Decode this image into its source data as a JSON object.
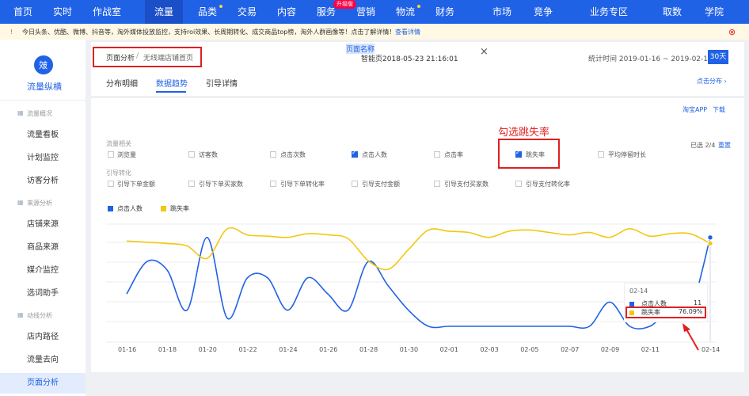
{
  "topnav": {
    "items": [
      "首页",
      "实时",
      "作战室",
      "流量",
      "品类",
      "交易",
      "内容",
      "服务",
      "营销",
      "物流",
      "财务",
      "市场",
      "竞争",
      "业务专区",
      "取数",
      "学院"
    ],
    "active": "流量",
    "upgrade_badge": "升级版"
  },
  "notice": {
    "icon": "!",
    "text": "今日头条、优酷、微博、抖音等，淘外媒体投放监控，支持roi效果、长周期转化、成交商品top榜，淘外人群画像等！点击了解详情！",
    "link": "查看详情",
    "close": "⊗"
  },
  "sidebar": {
    "logo_glyph": "㿰",
    "title": "流量纵横",
    "groups": [
      {
        "label": "流量概况",
        "items": [
          "流量看板",
          "计划监控",
          "访客分析"
        ]
      },
      {
        "label": "来源分析",
        "items": [
          "店铺来源",
          "商品来源",
          "媒介监控",
          "选词助手"
        ]
      },
      {
        "label": "动线分析",
        "items": [
          "店内路径",
          "流量去向",
          "页面分析"
        ]
      }
    ],
    "active": "页面分析"
  },
  "header": {
    "breadcrumb_root": "页面分析",
    "breadcrumb_sep": "/",
    "breadcrumb_current": "无线端店铺首页",
    "page_name_label": "页面名称",
    "page_name_value": "智能页2018-05-23 21:16:01",
    "close": "×",
    "stats_range": "统计时间 2019-01-16 ~ 2019-02-14",
    "range_button": "30天",
    "tabs": [
      "分布明细",
      "数据趋势",
      "引导详情"
    ],
    "active_tab": "数据趋势",
    "right_link": "点击分布 ›"
  },
  "panel": {
    "source_label": "淘宝APP",
    "download": "下载",
    "annotation": "勾选跳失率",
    "selected_count": "已选 2/4",
    "reset": "重置",
    "group1": "流量相关",
    "metrics1": [
      {
        "label": "浏览量",
        "checked": false
      },
      {
        "label": "访客数",
        "checked": false
      },
      {
        "label": "点击次数",
        "checked": false
      },
      {
        "label": "点击人数",
        "checked": true
      },
      {
        "label": "点击率",
        "checked": false
      },
      {
        "label": "跳失率",
        "checked": true
      },
      {
        "label": "平均停留时长",
        "checked": false
      }
    ],
    "group2": "引导转化",
    "metrics2": [
      {
        "label": "引导下单金额",
        "checked": false
      },
      {
        "label": "引导下单买家数",
        "checked": false
      },
      {
        "label": "引导下单转化率",
        "checked": false
      },
      {
        "label": "引导支付金额",
        "checked": false
      },
      {
        "label": "引导支付买家数",
        "checked": false
      },
      {
        "label": "引导支付转化率",
        "checked": false
      }
    ]
  },
  "chart_data": {
    "type": "line",
    "x": [
      "01-16",
      "01-17",
      "01-18",
      "01-19",
      "01-20",
      "01-21",
      "01-22",
      "01-23",
      "01-24",
      "01-25",
      "01-26",
      "01-27",
      "01-28",
      "01-29",
      "01-30",
      "01-31",
      "02-01",
      "02-02",
      "02-03",
      "02-04",
      "02-05",
      "02-06",
      "02-07",
      "02-08",
      "02-09",
      "02-10",
      "02-11",
      "02-12",
      "02-13",
      "02-14"
    ],
    "xticks": [
      "01-16",
      "01-18",
      "01-20",
      "01-22",
      "01-24",
      "01-26",
      "01-28",
      "01-30",
      "02-01",
      "02-03",
      "02-05",
      "02-07",
      "02-09",
      "02-11",
      "02-14"
    ],
    "series": [
      {
        "name": "点击人数",
        "color": "#2062e6",
        "values": [
          4,
          8,
          7,
          2,
          11,
          1,
          6,
          6,
          2,
          6,
          4,
          2,
          8,
          5,
          2,
          0,
          0,
          0,
          0,
          0,
          0,
          0,
          0,
          0,
          3,
          0,
          0,
          2,
          2,
          11
        ]
      },
      {
        "name": "跳失率",
        "color": "#f2c811",
        "values": [
          78,
          77,
          76,
          74,
          64,
          88,
          83,
          82,
          81,
          84,
          83,
          80,
          62,
          55,
          71,
          87,
          86,
          85,
          81,
          86,
          87,
          85,
          83,
          85,
          81,
          88,
          82,
          84,
          84,
          76.09
        ]
      }
    ],
    "tooltip": {
      "date": "02-14",
      "rows": [
        {
          "name": "点击人数",
          "value": "11"
        },
        {
          "name": "跳失率",
          "value": "76.09%"
        }
      ]
    },
    "legend_position": "top-left",
    "grid": "horizontal"
  }
}
